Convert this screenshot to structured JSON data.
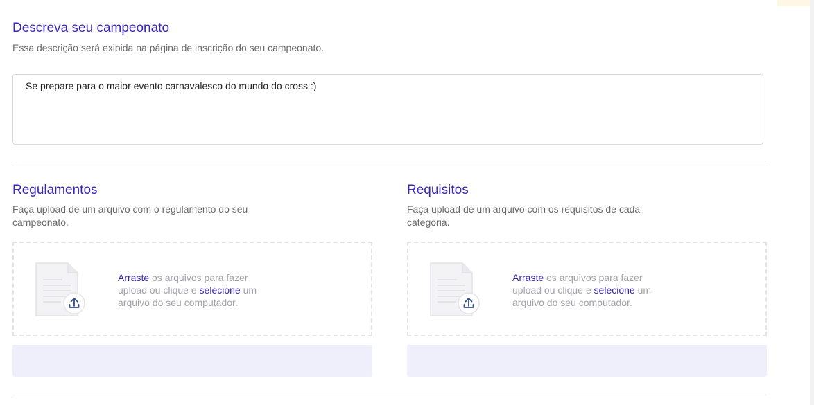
{
  "description": {
    "title": "Descreva seu campeonato",
    "subtitle": "Essa descrição será exibida na página de inscrição do seu campeonato.",
    "text": "Se prepare para o maior evento carnavalesco do mundo do cross :)"
  },
  "regulamentos": {
    "title": "Regulamentos",
    "subtitle_line1": "Faça upload de um arquivo com o regulamento do seu",
    "subtitle_line2": "campeonato.",
    "drop_line1_link": "Arraste",
    "drop_line1_rest": " os arquivos para fazer",
    "drop_line2_pre": "upload ou clique e ",
    "drop_line2_link": "selecione",
    "drop_line2_post": " um",
    "drop_line3": "arquivo do seu computador."
  },
  "requisitos": {
    "title": "Requisitos",
    "subtitle_line1": "Faça upload de um arquivo com os requisitos de cada",
    "subtitle_line2": "categoria.",
    "drop_line1_link": "Arraste",
    "drop_line1_rest": " os arquivos para fazer",
    "drop_line2_pre": "upload ou clique e ",
    "drop_line2_link": "selecione",
    "drop_line2_post": " um",
    "drop_line3": "arquivo do seu computador."
  },
  "icons": {
    "document": "document-upload-icon"
  },
  "colors": {
    "accent": "#3a27b0",
    "muted_text": "#6b6b6b",
    "file_bar": "#efeefb"
  }
}
